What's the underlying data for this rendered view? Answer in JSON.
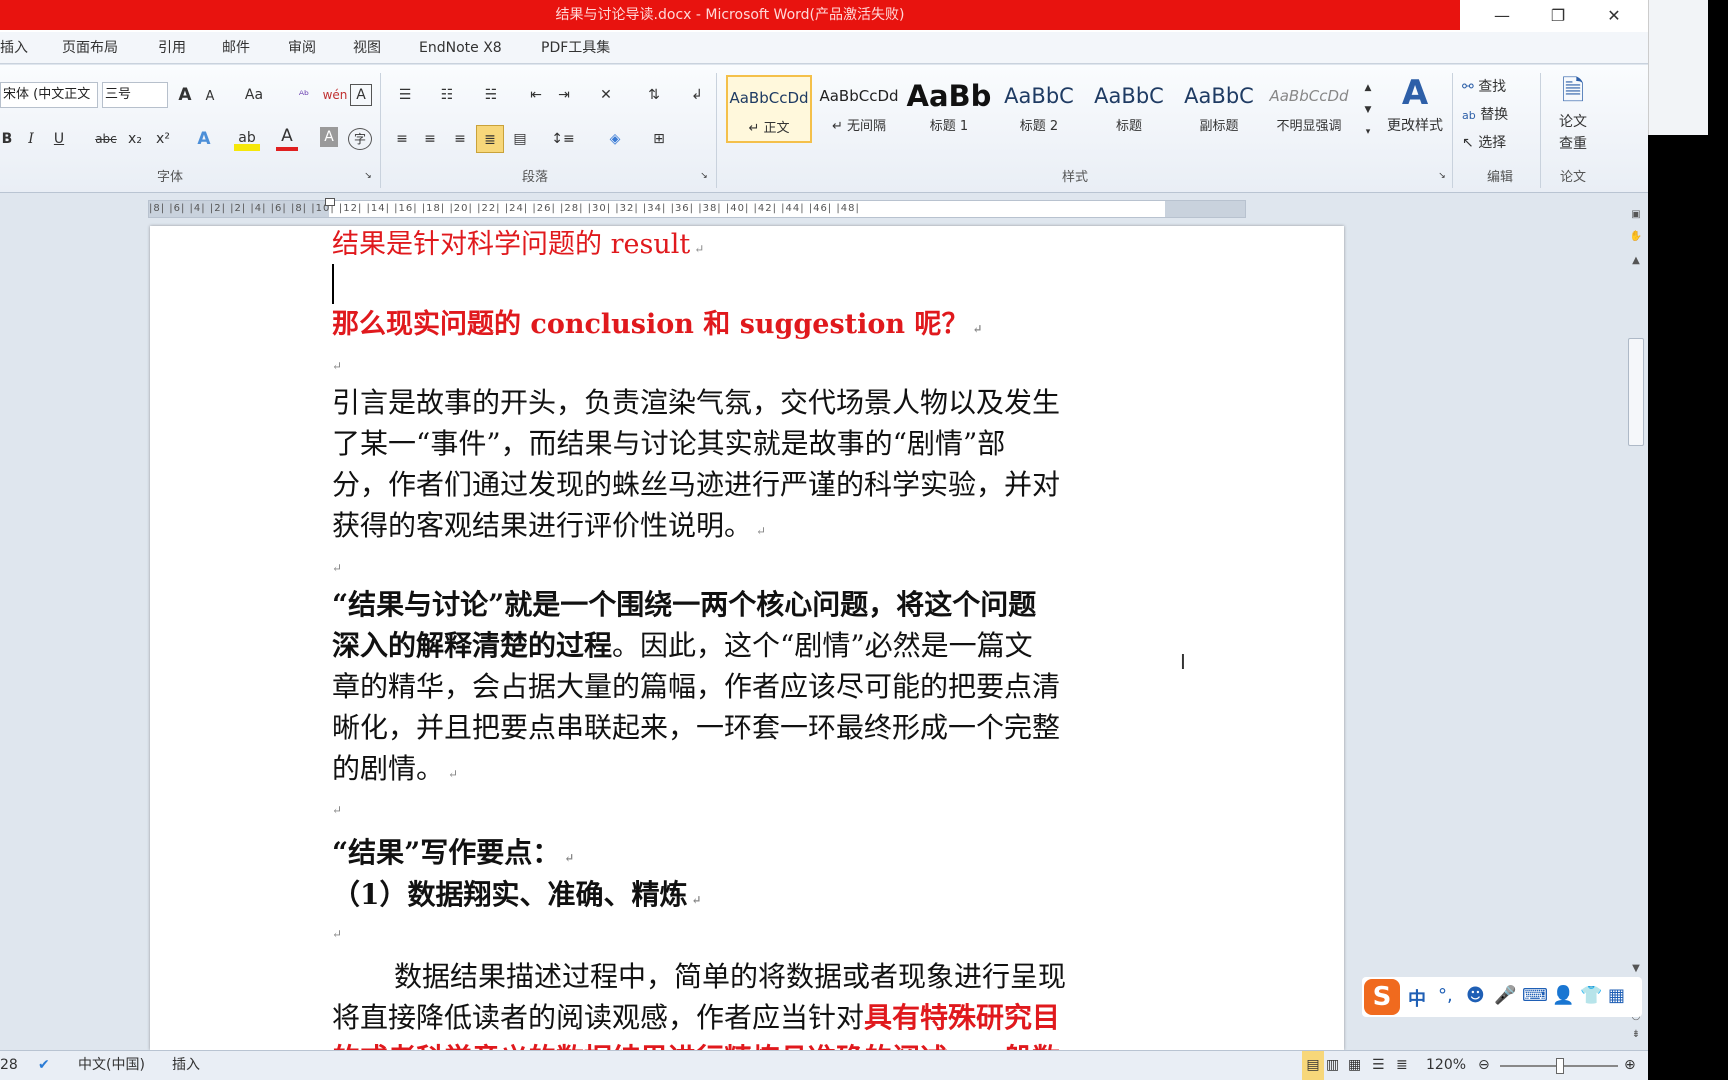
{
  "window": {
    "title": "结果与讨论导读.docx - Microsoft Word(产品激活失败)",
    "minimize": "—",
    "restore": "❐",
    "close": "✕"
  },
  "menu": {
    "items": [
      "插入",
      "页面布局",
      "引用",
      "邮件",
      "审阅",
      "视图",
      "EndNote X8",
      "PDF工具集"
    ]
  },
  "ribbon": {
    "font_name": "宋体 (中文正文",
    "font_size": "三号",
    "font_group": "字体",
    "paragraph_group": "段落",
    "styles_group": "样式",
    "edit_group": "编辑",
    "paper_group": "论文",
    "styles": [
      {
        "sample": "AaBbCcDd",
        "name": "↵ 正文"
      },
      {
        "sample": "AaBbCcDd",
        "name": "↵ 无间隔"
      },
      {
        "sample": "AaBb",
        "name": "标题 1"
      },
      {
        "sample": "AaBbC",
        "name": "标题 2"
      },
      {
        "sample": "AaBbC",
        "name": "标题"
      },
      {
        "sample": "AaBbC",
        "name": "副标题"
      },
      {
        "sample": "AaBbCcDd",
        "name": "不明显强调"
      }
    ],
    "change_styles": "更改样式",
    "find": "查找",
    "replace": "替换",
    "select": "选择",
    "paper_check_1": "论文",
    "paper_check_2": "查重",
    "font_buttons": {
      "grow": "A",
      "shrink": "A",
      "case": "Aa",
      "bold": "B",
      "italic": "I",
      "underline": "U",
      "strike": "abc",
      "subscript": "x₂",
      "superscript": "x²",
      "color": "A",
      "shade": "A",
      "phonetic": "wén",
      "charborder": "A",
      "enclose": "字"
    }
  },
  "ruler": {
    "ticks": "|8| |6| |4| |2| |2| |4| |6| |8| |10| |12| |14| |16| |18| |20| |22| |24| |26| |28| |30| |32| |34| |36| |38| |40| |42| |44| |46| |48|"
  },
  "document": {
    "line1": "结果是针对科学问题的 result",
    "line2": "那么现实问题的 conclusion 和 suggestion 呢？",
    "para1": [
      "引言是故事的开头，负责渲染气氛，交代场景人物以及发生",
      "了某一“事件”，而结果与讨论其实就是故事的“剧情”部",
      "分，作者们通过发现的蛛丝马迹进行严谨的科学实验，并对",
      "获得的客观结果进行评价性说明。"
    ],
    "para2_bold_a": "“结果与讨论”就是一个围绕一两个核心问题，将这个问题",
    "para2_bold_b": "深入的解释清楚的过程",
    "para2_rest_b": "。因此，这个“剧情”必然是一篇文",
    "para2_lines": [
      "章的精华，会占据大量的篇幅，作者应该尽可能的把要点清",
      "晰化，并且把要点串联起来，一环套一环最终形成一个完整",
      "的剧情。"
    ],
    "heading": "“结果”写作要点：",
    "point1": "（1）数据翔实、准确、精炼",
    "para3_line1": "数据结果描述过程中，简单的将数据或者现象进行呈现",
    "para3_line2_a": "将直接降低读者的阅读观感，作者应当针对",
    "para3_line2_b": "具有特殊研究目",
    "para3_line3": "的或者科学意义的数据结果进行精炼且准确的阐述。一般数",
    "pmark": "↵"
  },
  "status": {
    "page": "28",
    "language": "中文(中国)",
    "mode": "插入",
    "zoom": "120%"
  },
  "ime": {
    "logo": "S",
    "lang": "中"
  }
}
